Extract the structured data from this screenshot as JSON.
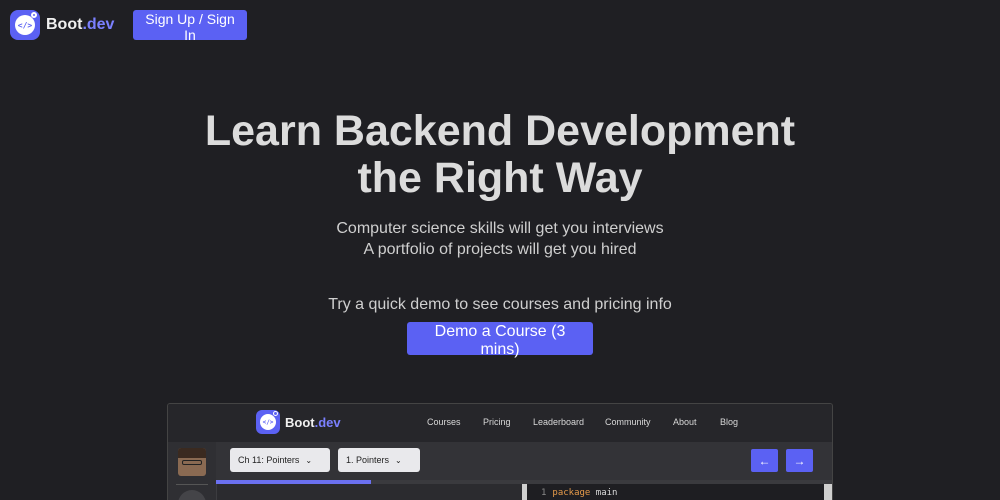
{
  "header": {
    "logo_text": "Boot",
    "logo_suffix": ".dev",
    "logo_icon": "robot-code-icon",
    "signup_label": "Sign Up / Sign In"
  },
  "hero": {
    "title_line1": "Learn Backend Development",
    "title_line2": "the Right Way",
    "subtitle_line1": "Computer science skills will get you interviews",
    "subtitle_line2": "A portfolio of projects will get you hired",
    "demo_prompt": "Try a quick demo to see courses and pricing info",
    "demo_button": "Demo a Course (3 mins)"
  },
  "preview": {
    "logo_text": "Boot",
    "logo_suffix": ".dev",
    "nav": [
      "Courses",
      "Pricing",
      "Leaderboard",
      "Community",
      "About",
      "Blog"
    ],
    "chapter_select": "Ch 11: Pointers",
    "lesson_select": "1. Pointers",
    "prev_icon": "arrow-left-icon",
    "next_icon": "arrow-right-icon",
    "code_line_number": "1",
    "code_keyword": "package",
    "code_rest": " main"
  },
  "colors": {
    "background": "#1f1f23",
    "accent": "#5b61f3",
    "text": "#dcdcdc"
  }
}
